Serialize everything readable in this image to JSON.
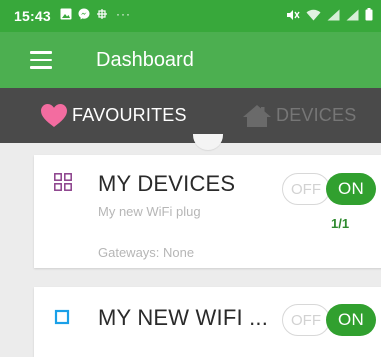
{
  "status_bar": {
    "time": "15:43",
    "overflow": "···",
    "icons_left": [
      "image-icon",
      "messenger-icon",
      "grid-icon"
    ],
    "icons_right": [
      "mute-icon",
      "wifi-icon",
      "signal-icon",
      "signal-icon",
      "battery-icon"
    ]
  },
  "app_bar": {
    "title": "Dashboard",
    "menu_icon": "hamburger-menu-icon"
  },
  "tabs": [
    {
      "label": "FAVOURITES",
      "icon": "heart-icon",
      "active": true,
      "icon_color": "#f36ca0"
    },
    {
      "label": "DEVICES",
      "icon": "house-icon",
      "active": false
    }
  ],
  "cards": [
    {
      "icon": "device-group-icon",
      "title": "MY DEVICES",
      "subtitle": "My new WiFi plug",
      "gateways": "Gateways: None",
      "off_label": "OFF",
      "on_label": "ON",
      "count": "1/1"
    },
    {
      "icon": "device-square-icon",
      "title": "MY NEW WIFI ...",
      "off_label": "OFF",
      "on_label": "ON"
    }
  ],
  "colors": {
    "status_bar": "#38a83b",
    "app_bar": "#4caf50",
    "tab_bar": "#4a4a4a",
    "on_button": "#31a02f",
    "heart": "#f36ca0",
    "device_icon": "#8a3f8a",
    "square_icon": "#1aa0e8"
  }
}
